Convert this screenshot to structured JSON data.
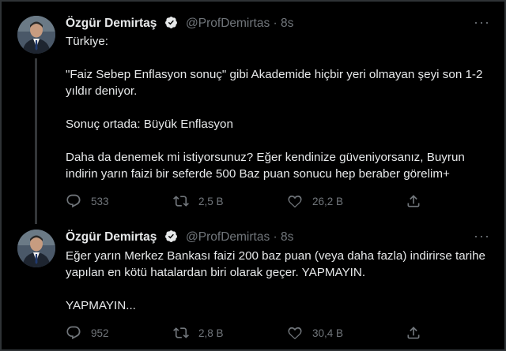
{
  "tweets": [
    {
      "name": "Özgür Demirtaş",
      "handle": "@ProfDemirtas",
      "separator": "·",
      "time": "8s",
      "paragraphs": [
        "Türkiye:",
        "\"Faiz Sebep Enflasyon sonuç\" gibi Akademide hiçbir yeri olmayan şeyi son 1-2 yıldır deniyor.",
        "Sonuç ortada: Büyük Enflasyon",
        "Daha da denemek mi istiyorsunuz? Eğer kendinize güveniyorsanız, Buyrun indirin yarın faizi bir seferde 500 Baz puan sonucu hep beraber görelim+"
      ],
      "replies": "533",
      "retweets": "2,5 B",
      "likes": "26,2 B"
    },
    {
      "name": "Özgür Demirtaş",
      "handle": "@ProfDemirtas",
      "separator": "·",
      "time": "8s",
      "paragraphs": [
        "Eğer yarın Merkez Bankası faizi 200 baz puan (veya daha fazla) indirirse tarihe yapılan en kötü hatalardan biri olarak geçer. YAPMAYIN.",
        "YAPMAYIN..."
      ],
      "replies": "952",
      "retweets": "2,8 B",
      "likes": "30,4 B"
    }
  ],
  "icons": {
    "verified": "verified-badge-icon",
    "more": "more-options-icon",
    "reply": "reply-icon",
    "retweet": "retweet-icon",
    "like": "heart-icon",
    "share": "share-icon"
  },
  "colors": {
    "background": "#000000",
    "text": "#e7e9ea",
    "muted": "#71767b",
    "border": "#2f3336"
  }
}
